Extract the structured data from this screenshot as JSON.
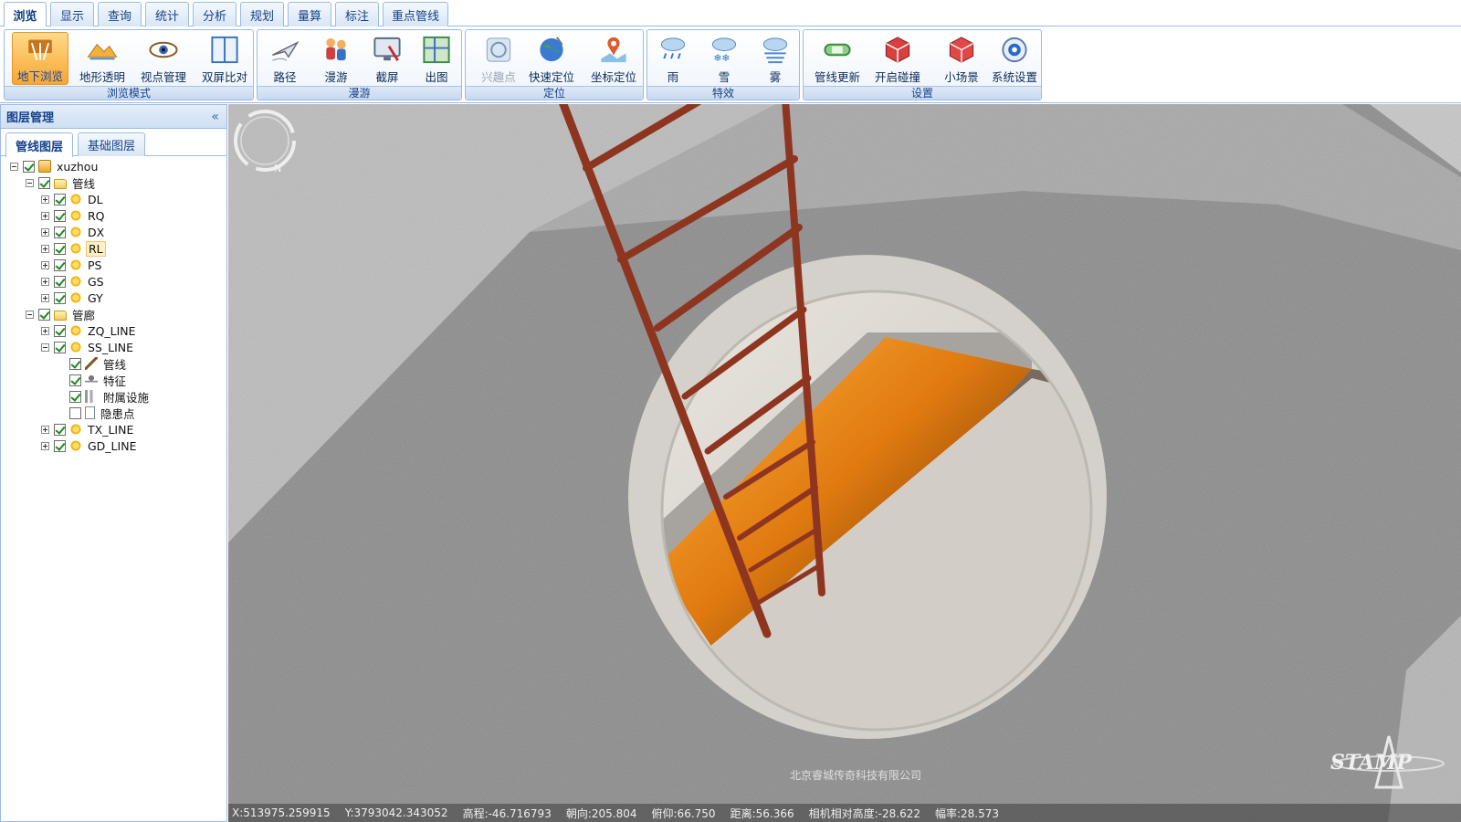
{
  "menu": {
    "tabs": [
      "浏览",
      "显示",
      "查询",
      "统计",
      "分析",
      "规划",
      "量算",
      "标注",
      "重点管线"
    ],
    "active": "浏览"
  },
  "ribbon": {
    "groups": [
      {
        "caption": "浏览模式",
        "buttons": [
          {
            "label": "地下浏览",
            "icon": "underground-browse-icon",
            "active": true
          },
          {
            "label": "地形透明",
            "icon": "terrain-transparent-icon"
          },
          {
            "label": "视点管理",
            "icon": "eye-icon"
          },
          {
            "label": "双屏比对",
            "icon": "split-screen-icon"
          }
        ]
      },
      {
        "caption": "漫游",
        "buttons": [
          {
            "label": "路径",
            "icon": "airplane-path-icon"
          },
          {
            "label": "漫游",
            "icon": "people-roam-icon"
          },
          {
            "label": "截屏",
            "icon": "screenshot-monitor-icon"
          },
          {
            "label": "出图",
            "icon": "map-output-icon"
          }
        ]
      },
      {
        "caption": "定位",
        "buttons": [
          {
            "label": "兴趣点",
            "icon": "poi-compass-icon",
            "disabled": true
          },
          {
            "label": "快速定位",
            "icon": "globe-icon"
          },
          {
            "label": "坐标定位",
            "icon": "map-pin-icon"
          }
        ]
      },
      {
        "caption": "特效",
        "buttons": [
          {
            "label": "雨",
            "icon": "rain-cloud-icon"
          },
          {
            "label": "雪",
            "icon": "snow-cloud-icon"
          },
          {
            "label": "雾",
            "icon": "fog-cloud-icon"
          }
        ]
      },
      {
        "caption": "设置",
        "buttons": [
          {
            "label": "管线更新",
            "icon": "pipe-update-icon"
          },
          {
            "label": "开启碰撞",
            "icon": "collision-cube-icon"
          },
          {
            "label": "小场景",
            "icon": "small-scene-cube-icon"
          },
          {
            "label": "系统设置",
            "icon": "system-settings-icon"
          }
        ]
      }
    ]
  },
  "panel": {
    "title": "图层管理",
    "tabs": [
      "管线图层",
      "基础图层"
    ],
    "active_tab": "管线图层"
  },
  "tree": [
    {
      "label": "xuzhou",
      "level": 0,
      "expanded": true,
      "checked": true,
      "icon": "database"
    },
    {
      "label": "管线",
      "level": 1,
      "expanded": true,
      "checked": true,
      "icon": "folder"
    },
    {
      "label": "DL",
      "level": 2,
      "expanded": false,
      "checked": true,
      "icon": "layer"
    },
    {
      "label": "RQ",
      "level": 2,
      "expanded": false,
      "checked": true,
      "icon": "layer"
    },
    {
      "label": "DX",
      "level": 2,
      "expanded": false,
      "checked": true,
      "icon": "layer"
    },
    {
      "label": "RL",
      "level": 2,
      "expanded": false,
      "checked": true,
      "icon": "layer",
      "selected": true
    },
    {
      "label": "PS",
      "level": 2,
      "expanded": false,
      "checked": true,
      "icon": "layer"
    },
    {
      "label": "GS",
      "level": 2,
      "expanded": false,
      "checked": true,
      "icon": "layer"
    },
    {
      "label": "GY",
      "level": 2,
      "expanded": false,
      "checked": true,
      "icon": "layer"
    },
    {
      "label": "管廊",
      "level": 1,
      "expanded": true,
      "checked": true,
      "icon": "folder"
    },
    {
      "label": "ZQ_LINE",
      "level": 2,
      "expanded": false,
      "checked": true,
      "icon": "layer"
    },
    {
      "label": "SS_LINE",
      "level": 2,
      "expanded": true,
      "checked": true,
      "icon": "layer"
    },
    {
      "label": "管线",
      "level": 3,
      "leaf": true,
      "checked": true,
      "icon": "pencil"
    },
    {
      "label": "特征",
      "level": 3,
      "leaf": true,
      "checked": true,
      "icon": "feature"
    },
    {
      "label": "附属设施",
      "level": 3,
      "leaf": true,
      "checked": true,
      "icon": "attach"
    },
    {
      "label": "隐患点",
      "level": 3,
      "leaf": true,
      "checked": false,
      "icon": "doc"
    },
    {
      "label": "TX_LINE",
      "level": 2,
      "expanded": false,
      "checked": true,
      "icon": "layer"
    },
    {
      "label": "GD_LINE",
      "level": 2,
      "expanded": false,
      "checked": true,
      "icon": "layer"
    }
  ],
  "viewport": {
    "watermark": "北京睿城传奇科技有限公司",
    "logo": "STAMP"
  },
  "status": {
    "x": "X:513975.259915",
    "y": "Y:3793042.343052",
    "elevation": "高程:-46.716793",
    "heading": "朝向:205.804",
    "pitch": "俯仰:66.750",
    "distance": "距离:56.366",
    "camera_height": "相机相对高度:-28.622",
    "zoom": "幅率:28.573"
  },
  "colors": {
    "accent": "#99bbe8",
    "active_button": "#f7a733",
    "pipe": "#e07a10",
    "ladder": "#9a3a22"
  }
}
